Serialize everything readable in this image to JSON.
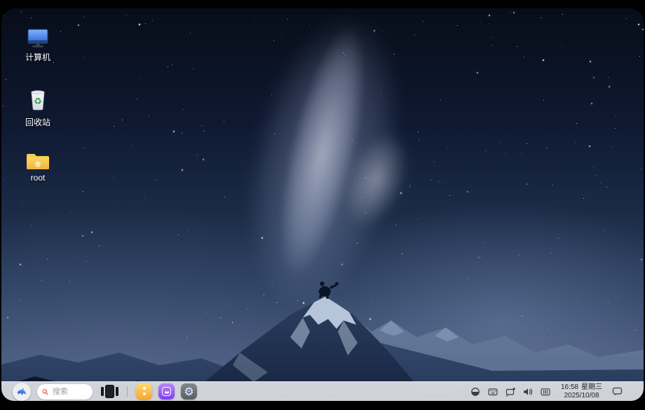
{
  "desktop": {
    "icons": [
      {
        "label": "计算机",
        "icon": "computer-icon"
      },
      {
        "label": "回收站",
        "icon": "recycle-bin-icon"
      },
      {
        "label": "root",
        "icon": "folder-icon"
      }
    ]
  },
  "taskbar": {
    "search": {
      "placeholder": "搜索"
    },
    "icons": {
      "launcher": "launcher-icon",
      "task_view": "task-view-icon",
      "ai": "uos-ai-icon",
      "store": "app-store-icon",
      "settings": "control-center-icon"
    },
    "tray": [
      "theme-mode-icon",
      "input-method-icon",
      "screen-cast-icon",
      "volume-icon",
      "tray-expand-icon"
    ],
    "clock": {
      "time": "16:58",
      "weekday": "星期三",
      "date": "2025/10/08"
    },
    "notification_icon": "notification-center-icon"
  },
  "colors": {
    "taskbar_bg": "#d7dade",
    "ai_orange": "#f6a62c",
    "store_purple": "#8b4df2",
    "settings_gray": "#63666d",
    "search_accent_start": "#f7941d",
    "search_accent_end": "#e8447a",
    "folder_yellow": "#f6c244",
    "computer_blue": "#3c79e6",
    "recycle_green": "#2fa24f",
    "sky_top": "#070d19",
    "sky_horizon": "#546685"
  }
}
